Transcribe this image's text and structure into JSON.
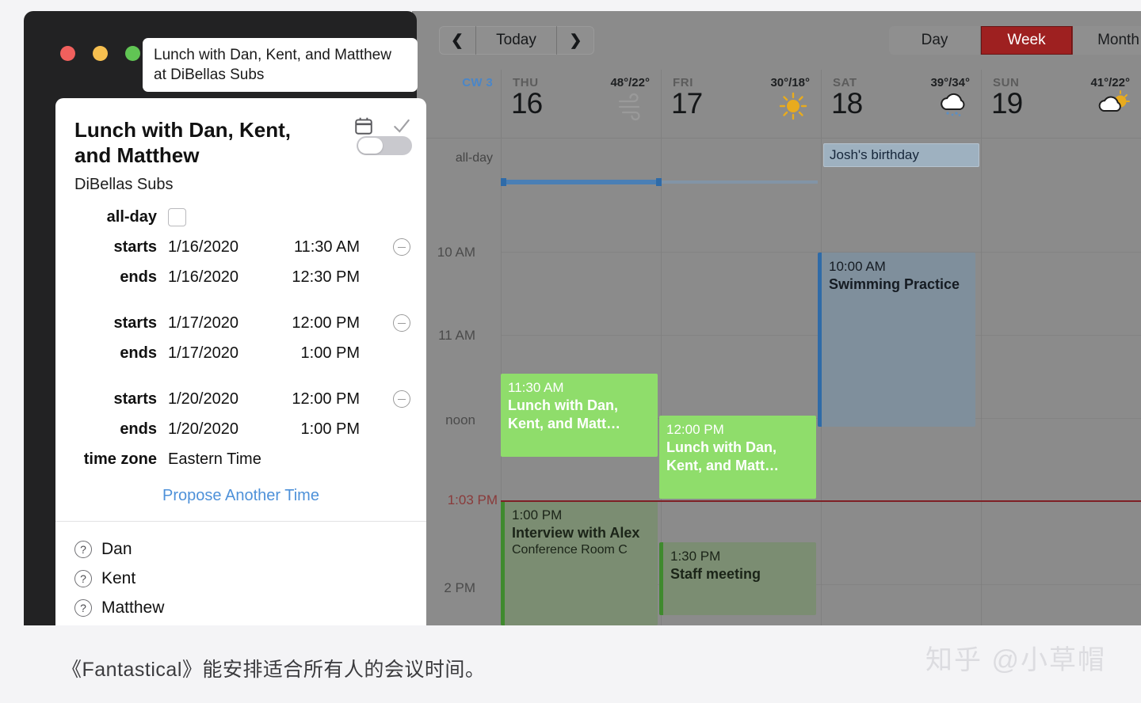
{
  "window": {
    "title_bar_text": "Lunch with Dan, Kent, and Matthew at DiBellas Subs"
  },
  "detail_panel": {
    "title": "Lunch with Dan, Kent, and Matthew",
    "location": "DiBellas Subs",
    "allday_label": "all-day",
    "time_rows": [
      {
        "label": "starts",
        "date": "1/16/2020",
        "time": "11:30 AM",
        "has_remove": true
      },
      {
        "label": "ends",
        "date": "1/16/2020",
        "time": "12:30 PM",
        "has_remove": false
      },
      {
        "label": "starts",
        "date": "1/17/2020",
        "time": "12:00 PM",
        "has_remove": true
      },
      {
        "label": "ends",
        "date": "1/17/2020",
        "time": "1:00 PM",
        "has_remove": false
      },
      {
        "label": "starts",
        "date": "1/20/2020",
        "time": "12:00 PM",
        "has_remove": true
      },
      {
        "label": "ends",
        "date": "1/20/2020",
        "time": "1:00 PM",
        "has_remove": false
      }
    ],
    "timezone_label": "time zone",
    "timezone_value": "Eastern Time",
    "propose_link": "Propose Another Time",
    "attendees": [
      {
        "name": "Dan",
        "status_icon": "question-mark"
      },
      {
        "name": "Kent",
        "status_icon": "question-mark"
      },
      {
        "name": "Matthew",
        "status_icon": "question-mark"
      }
    ],
    "icons": {
      "calendar": "calendar-icon",
      "check": "check-icon",
      "toggle_state": "off"
    }
  },
  "calendar": {
    "toolbar": {
      "prev_label": "❮",
      "today_label": "Today",
      "next_label": "❯",
      "views": [
        {
          "label": "Day",
          "active": false
        },
        {
          "label": "Week",
          "active": true
        },
        {
          "label": "Month",
          "active": false
        }
      ],
      "active_view_color": "#9e2020"
    },
    "week_number": "CW 3",
    "days": [
      {
        "dow": "THU",
        "num": "16",
        "temp": "48°/22°",
        "weather": "wind-icon"
      },
      {
        "dow": "FRI",
        "num": "17",
        "temp": "30°/18°",
        "weather": "sun-icon"
      },
      {
        "dow": "SAT",
        "num": "18",
        "temp": "39°/34°",
        "weather": "rain-cloud-icon"
      },
      {
        "dow": "SUN",
        "num": "19",
        "temp": "41°/22°",
        "weather": "partly-cloudy-icon"
      }
    ],
    "allday_label": "all-day",
    "allday_events": [
      {
        "day_index": 2,
        "title": "Josh's birthday"
      }
    ],
    "hour_labels": [
      "10 AM",
      "11 AM",
      "noon",
      "2 PM"
    ],
    "current_time": "1:03 PM",
    "events": [
      {
        "day_index": 0,
        "time": "11:30 AM",
        "title": "Lunch with Dan, Kent, and Matt…",
        "location": "",
        "style": "bright"
      },
      {
        "day_index": 1,
        "time": "12:00 PM",
        "title": "Lunch with Dan, Kent, and Matt…",
        "location": "",
        "style": "bright"
      },
      {
        "day_index": 2,
        "time": "10:00 AM",
        "title": "Swimming Practice",
        "location": "",
        "style": "blue"
      },
      {
        "day_index": 0,
        "time": "1:00 PM",
        "title": "Interview with Alex",
        "location": "Conference Room C",
        "style": "muted"
      },
      {
        "day_index": 1,
        "time": "1:30 PM",
        "title": "Staff meeting",
        "location": "",
        "style": "muted"
      }
    ]
  },
  "caption": {
    "text": "《Fantastical》能安排适合所有人的会议时间。",
    "watermark": "知乎 @小草帽"
  }
}
